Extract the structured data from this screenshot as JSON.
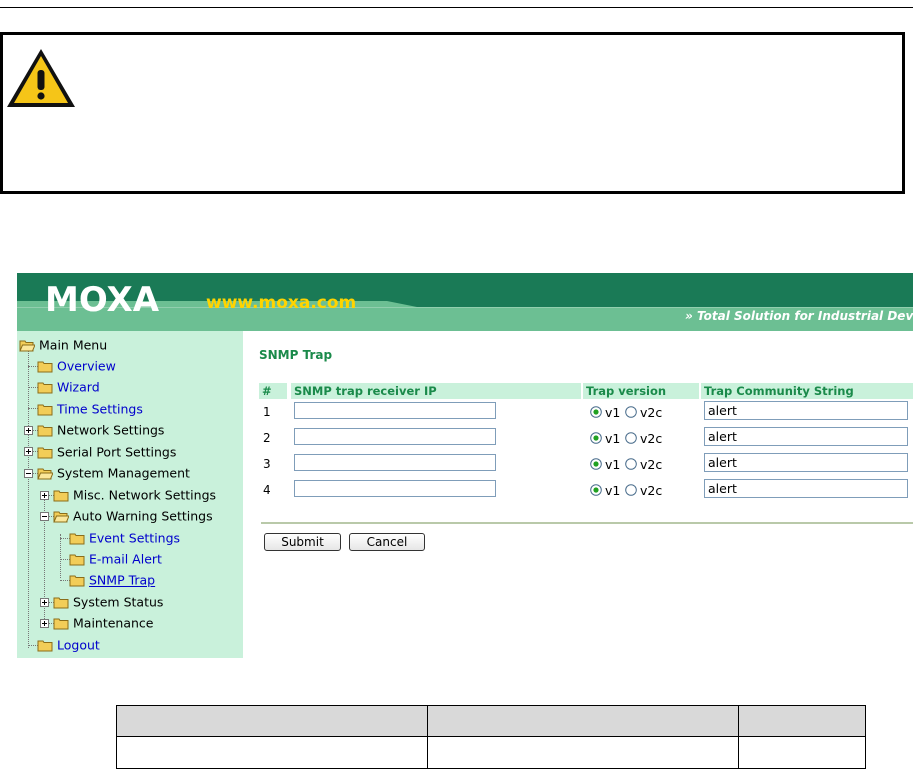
{
  "banner": {
    "logo_text": "MOXA",
    "url": "www.moxa.com",
    "slogan": "» Total Solution for Industrial Devi"
  },
  "menu": {
    "root": "Main Menu",
    "overview": "Overview",
    "wizard": "Wizard",
    "time_settings": "Time Settings",
    "network_settings": "Network Settings",
    "serial_port_settings": "Serial Port Settings",
    "system_management": "System Management",
    "misc_network_settings": "Misc. Network Settings",
    "auto_warning_settings": "Auto Warning Settings",
    "event_settings": "Event Settings",
    "email_alert": "E-mail Alert",
    "snmp_trap": "SNMP Trap",
    "system_status": "System Status",
    "maintenance": "Maintenance",
    "logout": "Logout"
  },
  "page": {
    "title": "SNMP Trap",
    "headers": {
      "num": "#",
      "ip": "SNMP trap receiver IP",
      "version": "Trap version",
      "community": "Trap Community String"
    },
    "rows": [
      {
        "num": "1",
        "ip": "",
        "v1": "v1",
        "v2c": "v2c",
        "selected": "v1",
        "community": "alert"
      },
      {
        "num": "2",
        "ip": "",
        "v1": "v1",
        "v2c": "v2c",
        "selected": "v1",
        "community": "alert"
      },
      {
        "num": "3",
        "ip": "",
        "v1": "v1",
        "v2c": "v2c",
        "selected": "v1",
        "community": "alert"
      },
      {
        "num": "4",
        "ip": "",
        "v1": "v1",
        "v2c": "v2c",
        "selected": "v1",
        "community": "alert"
      }
    ],
    "submit_label": "Submit",
    "cancel_label": "Cancel"
  },
  "colors": {
    "banner_green": "#1a7a56",
    "banner_light": "#6cbf93",
    "sidebar_bg": "#c9f1db",
    "accent_yellow": "#ffd400",
    "title_green": "#1a8a4a",
    "link_blue": "#0000cc"
  },
  "icons": {
    "warning": "warning-triangle-icon",
    "folder": "folder-icon",
    "folder_open": "folder-open-icon",
    "expand": "plus-box-icon",
    "collapse": "minus-box-icon"
  }
}
